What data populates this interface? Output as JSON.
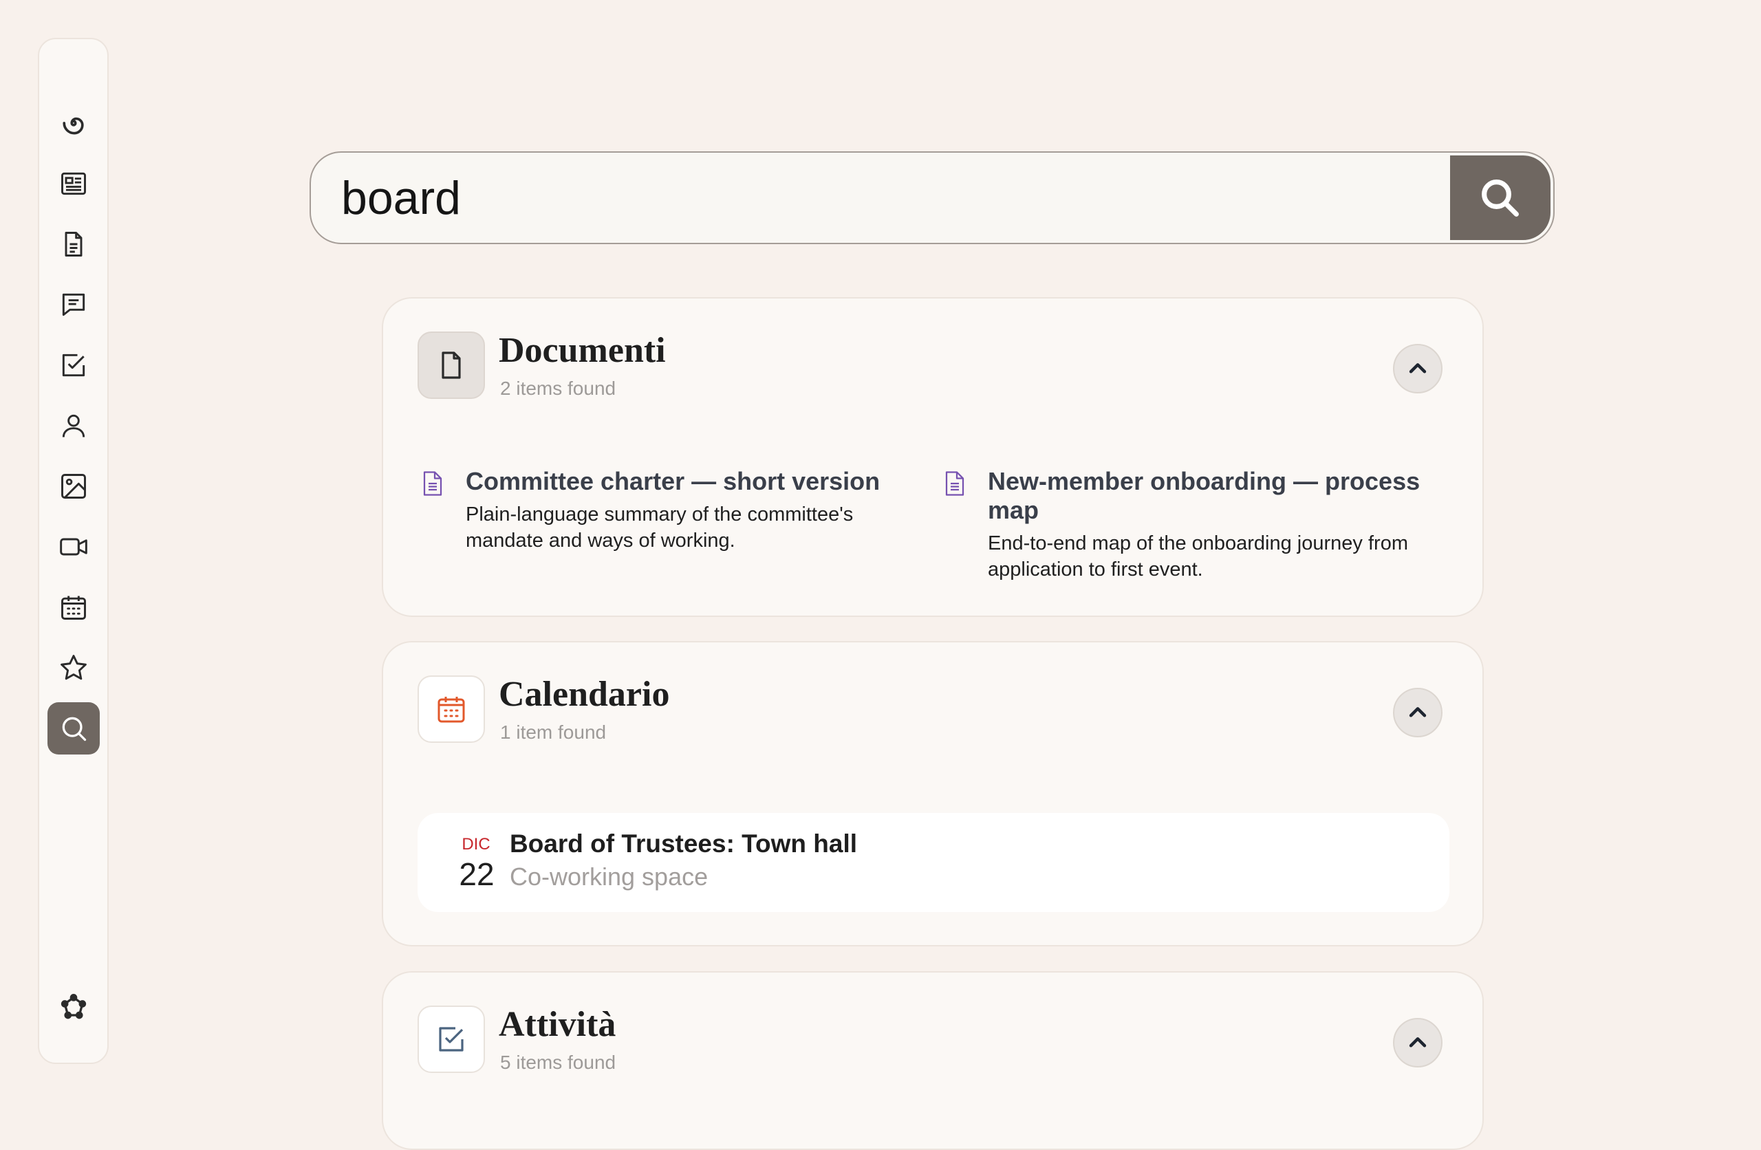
{
  "sidebar": {
    "items": [
      {
        "name": "home-logo-icon",
        "label": "Home"
      },
      {
        "name": "news-icon",
        "label": "News"
      },
      {
        "name": "documents-icon",
        "label": "Documents"
      },
      {
        "name": "messages-icon",
        "label": "Messages"
      },
      {
        "name": "tasks-icon",
        "label": "Tasks"
      },
      {
        "name": "people-icon",
        "label": "People"
      },
      {
        "name": "images-icon",
        "label": "Images"
      },
      {
        "name": "video-icon",
        "label": "Video"
      },
      {
        "name": "calendar-icon",
        "label": "Calendar"
      },
      {
        "name": "favorites-icon",
        "label": "Favorites"
      },
      {
        "name": "search-icon",
        "label": "Search",
        "active": true
      }
    ],
    "bottom": {
      "name": "network-settings-icon"
    }
  },
  "search": {
    "query": "board",
    "button_icon": "search-icon"
  },
  "sections": {
    "documents": {
      "title": "Documenti",
      "count": "2 items found",
      "icon": "file-icon",
      "items": [
        {
          "title": "Committee charter — short version",
          "description": "Plain-language summary of the committee's mandate and ways of working."
        },
        {
          "title": "New-member onboarding — process map",
          "description": "End-to-end map of the onboarding journey from application to first event."
        }
      ]
    },
    "calendar": {
      "title": "Calendario",
      "count": "1 item found",
      "icon": "calendar-icon",
      "events": [
        {
          "month": "DIC",
          "day": "22",
          "title": "Board of Trustees: Town hall",
          "location": "Co-working space"
        }
      ]
    },
    "tasks": {
      "title": "Attività",
      "count": "5 items found",
      "icon": "checkbox-icon"
    }
  },
  "colors": {
    "background": "#f8f1ec",
    "accent": "#6f6761",
    "document_icon": "#7651b0",
    "calendar_icon": "#e2582b",
    "task_icon": "#4b6480",
    "event_month": "#c7282d"
  }
}
